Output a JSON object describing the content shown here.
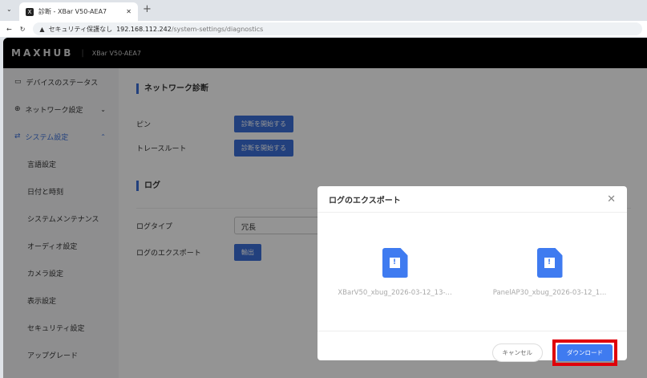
{
  "browser": {
    "tab_title": "診断 - XBar V50-AEA7",
    "tab_icon": "X",
    "security": "セキュリティ保護なし",
    "url_host": "192.168.112.242",
    "url_path": "/system-settings/diagnostics"
  },
  "header": {
    "logo": "MAXHUB",
    "device": "XBar V50-AEA7"
  },
  "sidebar": {
    "items": [
      {
        "label": "デバイスのステータス",
        "icon": "monitor-icon"
      },
      {
        "label": "ネットワーク設定",
        "icon": "globe-icon"
      },
      {
        "label": "システム設定",
        "icon": "swap-icon"
      },
      {
        "label": "言語設定"
      },
      {
        "label": "日付と時刻"
      },
      {
        "label": "システムメンテナンス"
      },
      {
        "label": "オーディオ設定"
      },
      {
        "label": "カメラ設定"
      },
      {
        "label": "表示設定"
      },
      {
        "label": "セキュリティ設定"
      },
      {
        "label": "アップグレード"
      }
    ]
  },
  "main": {
    "network_title": "ネットワーク診断",
    "ping_label": "ピン",
    "ping_button": "診断を開始する",
    "trace_label": "トレースルート",
    "trace_button": "診断を開始する",
    "log_title": "ログ",
    "log_type_label": "ログタイプ",
    "log_type_value": "冗長",
    "export_label": "ログのエクスポート",
    "export_button": "輸出"
  },
  "modal": {
    "title": "ログのエクスポート",
    "files": [
      "XBarV50_xbug_2026-03-12_13-...",
      "PanelAP30_xbug_2026-03-12_1..."
    ],
    "cancel": "キャンセル",
    "download": "ダウンロード"
  },
  "colors": {
    "accent": "#3b6fd8",
    "highlight": "#e0000a"
  }
}
